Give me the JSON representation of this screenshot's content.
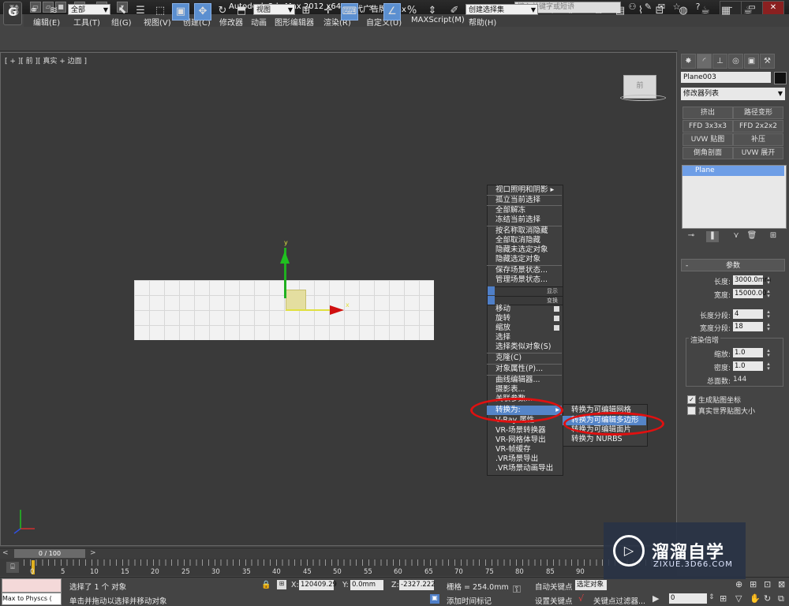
{
  "titlebar": {
    "app_title": "Autodesk 3ds Max  2012 x64",
    "document": "现代广告牌.max",
    "search_placeholder": "键入关键字或短语",
    "logo_glyph": "G"
  },
  "menubar": {
    "items": [
      "编辑(E)",
      "工具(T)",
      "组(G)",
      "视图(V)",
      "创建(C)",
      "修改器",
      "动画",
      "图形编辑器",
      "渲染(R)",
      "自定义(U)",
      "MAXScript(M)",
      "帮助(H)"
    ]
  },
  "toolbar": {
    "selection_filter": "全部",
    "coordinate_system": "视图",
    "named_selection": "创建选择集"
  },
  "viewport": {
    "label": "[ + ][ 前 ][ 真实 + 边面 ]",
    "viewcube_label": "前",
    "gizmo_y": "y",
    "gizmo_x": "x"
  },
  "quad_menu": {
    "upper": [
      "视口照明和阴影 ▸",
      "孤立当前选择",
      "全部解冻",
      "冻结当前选择",
      "按名称取消隐藏",
      "全部取消隐藏",
      "隐藏未选定对象",
      "隐藏选定对象",
      "保存场景状态...",
      "管理场景状态..."
    ],
    "section_display": "显示",
    "section_transform": "变换",
    "lower": [
      "移动",
      "旋转",
      "缩放",
      "选择",
      "选择类似对象(S)",
      "克隆(C)",
      "对象属性(P)...",
      "曲线编辑器...",
      "摄影表...",
      "关联参数...",
      "转换为:",
      "V-Ray 属性",
      "VR-场景转换器",
      "VR-网格体导出",
      "VR-帧缓存",
      ".VR场景导出",
      ".VR场景动画导出"
    ],
    "highlighted": "转换为:",
    "submenu": [
      "转换为可编辑网格",
      "转换为可编辑多边形",
      "转换为可编辑面片",
      "转换为 NURBS"
    ],
    "submenu_highlighted": "转换为可编辑多边形"
  },
  "command_panel": {
    "object_name": "Plane003",
    "modifier_list": "修改器列表",
    "modifier_buttons": [
      "挤出",
      "路径变形",
      "FFD 3x3x3",
      "FFD 2x2x2",
      "UVW 贴图",
      "补压",
      "倒角剖面",
      "UVW 展开"
    ],
    "stack_item": "Plane",
    "rollout_title": "参数",
    "length_label": "长度:",
    "length_value": "3000.0mm",
    "width_label": "宽度:",
    "width_value": "15000.00",
    "length_segs_label": "长度分段:",
    "length_segs_value": "4",
    "width_segs_label": "宽度分段:",
    "width_segs_value": "18",
    "render_mult_label": "渲染倍增",
    "scale_label": "缩放:",
    "scale_value": "1.0",
    "density_label": "密度:",
    "density_value": "1.0",
    "total_faces_label": "总面数:",
    "total_faces_value": "144",
    "gen_uv_label": "生成贴图坐标",
    "gen_uv_checked": true,
    "real_world_label": "真实世界贴图大小",
    "real_world_checked": false
  },
  "timeline": {
    "frame_display": "0 / 100",
    "ticks": [
      "0",
      "5",
      "10",
      "15",
      "20",
      "25",
      "30",
      "35",
      "40",
      "45",
      "50",
      "55",
      "60",
      "65",
      "70",
      "75",
      "80",
      "85",
      "90"
    ]
  },
  "statusbar": {
    "maxscript_text": "Max to Physcs (",
    "status_selected": "选择了 1 个 对象",
    "prompt": "单击并拖动以选择并移动对象",
    "x_label": "X:",
    "x_value": "120409.29",
    "y_label": "Y:",
    "y_value": "0.0mm",
    "z_label": "Z:",
    "z_value": "-2327.222",
    "grid": "栅格 = 254.0mm",
    "add_time_tag": "添加时间标记",
    "auto_key": "自动关键点",
    "selected_obj": "选定对象",
    "set_key": "设置关键点",
    "key_filters": "关键点过滤器...",
    "frame_value": "0"
  },
  "watermark": {
    "title": "溜溜自学",
    "url": "ZIXUE.3D66.COM"
  }
}
